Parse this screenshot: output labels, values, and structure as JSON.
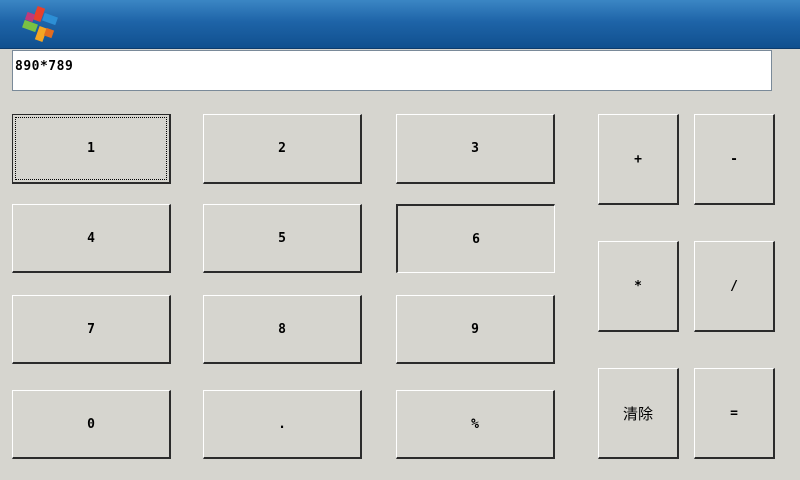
{
  "titlebar": {
    "logo_icon": "pinwheel-logo-icon"
  },
  "display": {
    "value": "890*789"
  },
  "keypad": {
    "k1": "1",
    "k2": "2",
    "k3": "3",
    "k4": "4",
    "k5": "5",
    "k6": "6",
    "k7": "7",
    "k8": "8",
    "k9": "9",
    "k0": "0",
    "dot": ".",
    "percent": "%"
  },
  "operators": {
    "plus": "+",
    "minus": "-",
    "multiply": "*",
    "divide": "/",
    "clear": "清除",
    "equals": "="
  },
  "colors": {
    "titlebar_top": "#3b86c4",
    "titlebar_bottom": "#10508f",
    "background": "#d6d5cf"
  }
}
